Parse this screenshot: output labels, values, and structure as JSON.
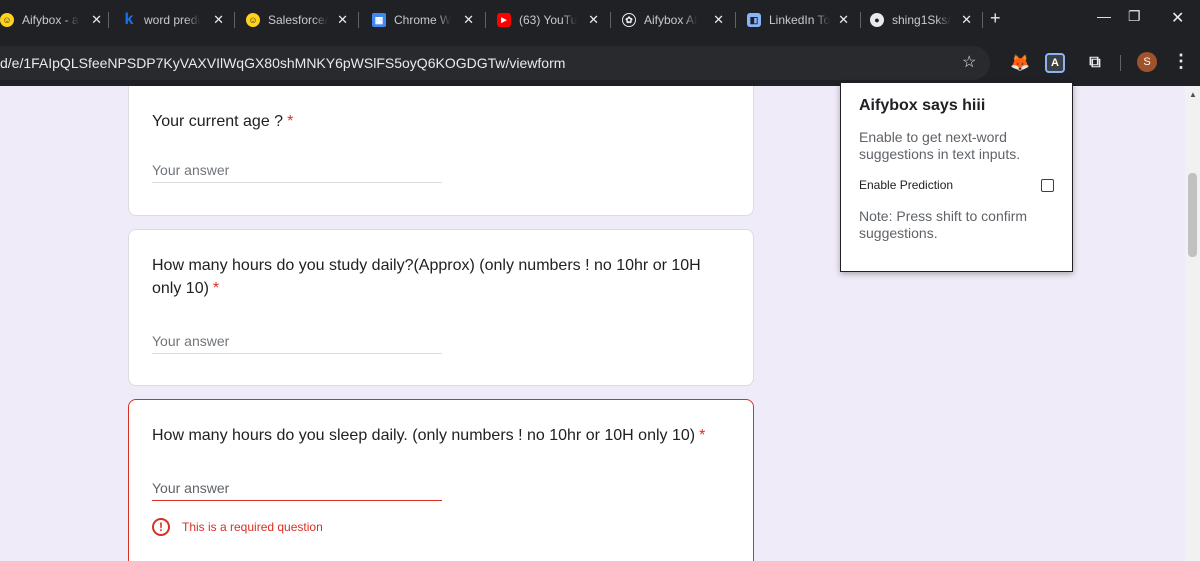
{
  "browser": {
    "tabs": [
      {
        "label": "Aifybox - a",
        "favicon": "hugging-face-icon",
        "favicon_color": "#ffd21e"
      },
      {
        "label": "word predi",
        "favicon": "k-icon",
        "favicon_color": "#1a73e8"
      },
      {
        "label": "Salesforce/",
        "favicon": "hugging-face-icon",
        "favicon_color": "#ffd21e"
      },
      {
        "label": "Chrome W",
        "favicon": "chrome-web-store-icon",
        "favicon_color": "#4285f4"
      },
      {
        "label": "(63) YouTu",
        "favicon": "youtube-icon",
        "favicon_color": "#ff0000"
      },
      {
        "label": "Aifybox AI",
        "favicon": "openai-icon",
        "favicon_color": "#e8eaed"
      },
      {
        "label": "LinkedIn To",
        "favicon": "linkedin-icon",
        "favicon_color": "#8ab4f8"
      },
      {
        "label": "shing1Sks/",
        "favicon": "github-icon",
        "favicon_color": "#e8eaed"
      }
    ],
    "close_glyph": "✕",
    "new_tab_glyph": "+",
    "url": "d/e/1FAIpQLSfeeNPSDP7KyVAXVIlWqGX80shMNKY6pWSlFS5oyQ6KOGDGTw/viewform",
    "avatar_letter": "S",
    "ext_active_letter": "A"
  },
  "form": {
    "questions": [
      {
        "text": "Your current age ?",
        "required_mark": "*",
        "answer_placeholder": "Your answer"
      },
      {
        "text": "How many hours do you study daily?(Approx) (only numbers ! no 10hr or 10H only 10)",
        "required_mark": "*",
        "answer_placeholder": "Your answer"
      },
      {
        "text": "How many hours  do you sleep daily. (only numbers ! no 10hr or 10H only 10)",
        "required_mark": "*",
        "answer_placeholder": "Your answer",
        "error": "This is a required question"
      }
    ]
  },
  "popup": {
    "title": "Aifybox says hiii",
    "description": "Enable to get next-word suggestions in text inputs.",
    "toggle_label": "Enable Prediction",
    "toggle_checked": false,
    "note": "Note: Press shift to confirm suggestions."
  },
  "colors": {
    "page_bg": "#f0ebf8",
    "error": "#d93025",
    "chrome_dark": "#202124"
  }
}
